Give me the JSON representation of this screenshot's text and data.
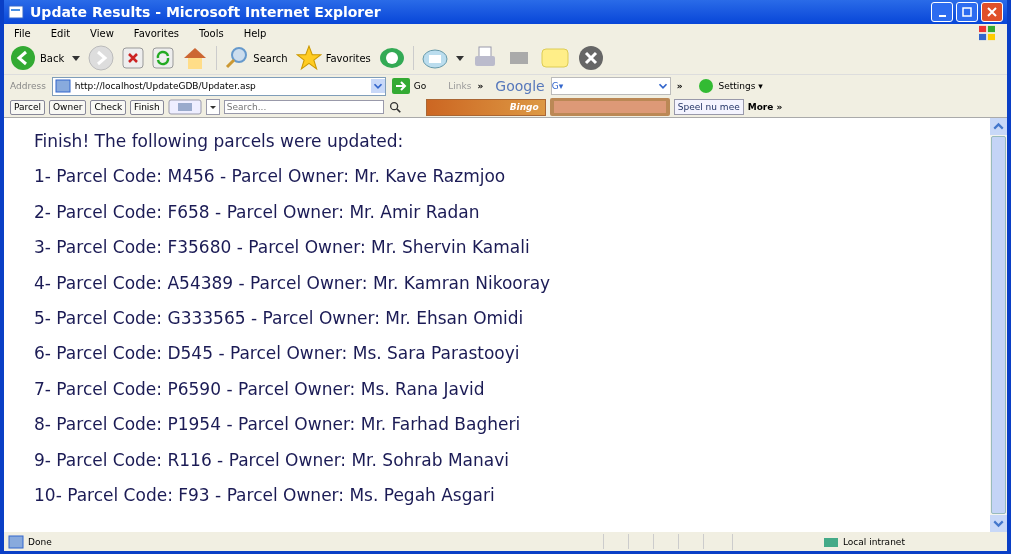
{
  "window": {
    "title": "Update Results - Microsoft Internet Explorer"
  },
  "menu": [
    "File",
    "Edit",
    "View",
    "Favorites",
    "Tools",
    "Help"
  ],
  "toolbar": {
    "back": "Back",
    "search": "Search",
    "favorites": "Favorites"
  },
  "address_bar": {
    "label": "Address",
    "url": "http://localhost/UpdateGDB/Updater.asp",
    "go": "Go",
    "links": "Links",
    "more": "»",
    "google": "Google",
    "google_menu": "G▾",
    "google_more": "»",
    "settings": "Settings ▾"
  },
  "custom_toolbar": {
    "buttons": [
      "Parcel",
      "Owner",
      "Check",
      "Finish"
    ],
    "search": {
      "placeholder": "Search..."
    },
    "bingo": "Bingo",
    "speel": "Speel nu mee",
    "more": "More »"
  },
  "content": {
    "heading": "Finish! The following parcels were updated:",
    "lines": [
      "1- Parcel Code: M456 - Parcel Owner: Mr. Kave Razmjoo",
      "2- Parcel Code: F658 - Parcel Owner: Mr. Amir Radan",
      "3- Parcel Code: F35680 - Parcel Owner: Mr. Shervin Kamali",
      "4- Parcel Code: A54389 - Parcel Owner: Mr. Kamran Nikooray",
      "5- Parcel Code: G333565 - Parcel Owner: Mr. Ehsan Omidi",
      "6- Parcel Code: D545 - Parcel Owner: Ms. Sara Parastooyi",
      "7- Parcel Code: P6590 - Parcel Owner: Ms. Rana Javid",
      "8- Parcel Code: P1954 - Parcel Owner: Mr. Farhad Bagheri",
      "9- Parcel Code: R116 - Parcel Owner: Mr. Sohrab Manavi",
      "10- Parcel Code: F93 - Parcel Owner: Ms. Pegah Asgari"
    ]
  },
  "status_bar": {
    "text": "Done",
    "zone": "Local intranet"
  }
}
